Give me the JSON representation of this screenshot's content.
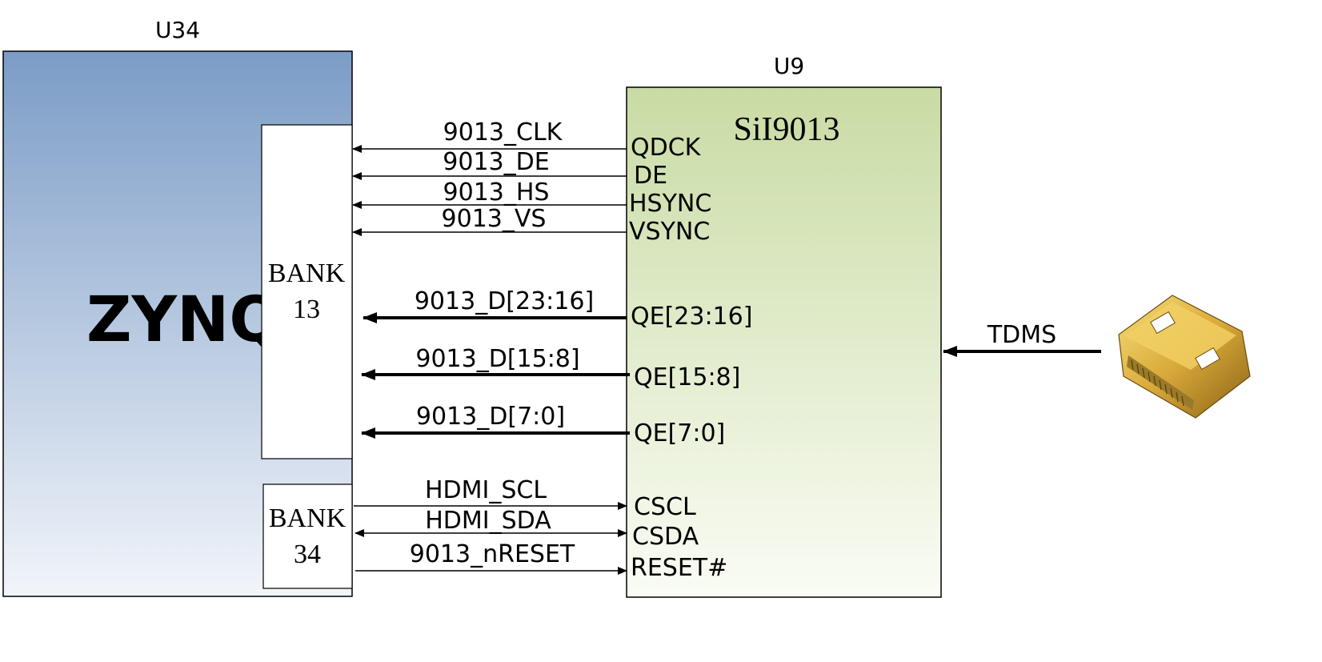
{
  "u34": {
    "ref": "U34",
    "name": "ZYNQ",
    "bank13": {
      "line1": "BANK",
      "line2": "13"
    },
    "bank34": {
      "line1": "BANK",
      "line2": "34"
    }
  },
  "u9": {
    "ref": "U9",
    "name": "SiI9013",
    "pins": {
      "qdck": "QDCK",
      "de": "DE",
      "hsync": "HSYNC",
      "vsync": "VSYNC",
      "qe_hi": "QE[23:16]",
      "qe_mid": "QE[15:8]",
      "qe_lo": "QE[7:0]",
      "cscl": "CSCL",
      "csda": "CSDA",
      "reset": "RESET#"
    }
  },
  "signals": {
    "clk": "9013_CLK",
    "de": "9013_DE",
    "hs": "9013_HS",
    "vs": "9013_VS",
    "d_hi": "9013_D[23:16]",
    "d_mid": "9013_D[15:8]",
    "d_lo": "9013_D[7:0]",
    "scl": "HDMI_SCL",
    "sda": "HDMI_SDA",
    "nreset": "9013_nRESET",
    "tdms": "TDMS"
  },
  "colors": {
    "zynq_top": "#7b9cc6",
    "zynq_bottom": "#f2f5fa",
    "u9_top": "#c9dba4",
    "u9_bottom": "#fafcf5",
    "line": "#000000"
  }
}
